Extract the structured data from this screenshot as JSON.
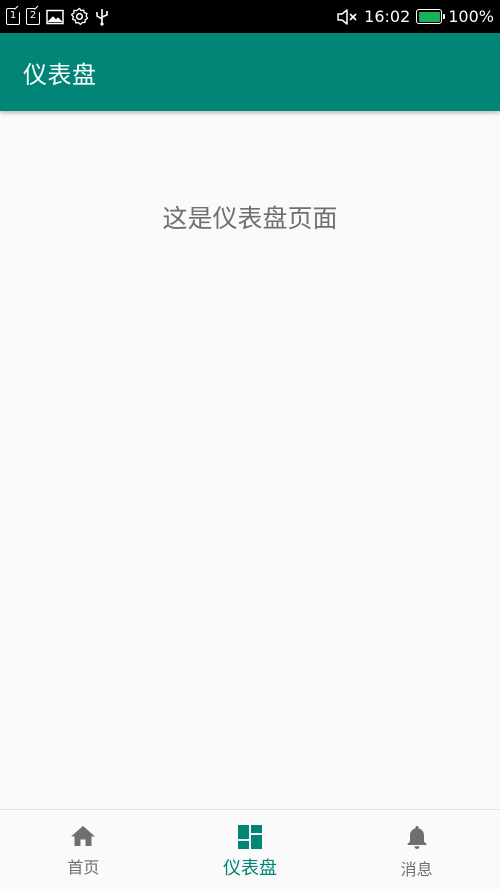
{
  "status_bar": {
    "sim1": "1",
    "sim2": "2",
    "icons": [
      "sim1-icon",
      "sim2-icon",
      "image-icon",
      "settings-icon",
      "usb-icon",
      "mute-icon",
      "battery-icon"
    ],
    "time": "16:02",
    "battery_percent": "100%",
    "battery_level": 1.0
  },
  "app_bar": {
    "title": "仪表盘"
  },
  "content": {
    "message": "这是仪表盘页面"
  },
  "bottom_nav": {
    "items": [
      {
        "label": "首页",
        "icon": "home-icon",
        "active": false
      },
      {
        "label": "仪表盘",
        "icon": "dashboard-icon",
        "active": true
      },
      {
        "label": "消息",
        "icon": "bell-icon",
        "active": false
      }
    ]
  },
  "colors": {
    "primary": "#008577",
    "status_bar": "#000000",
    "background": "#fafafa",
    "inactive": "#6f6f6f",
    "battery": "#18b058"
  }
}
